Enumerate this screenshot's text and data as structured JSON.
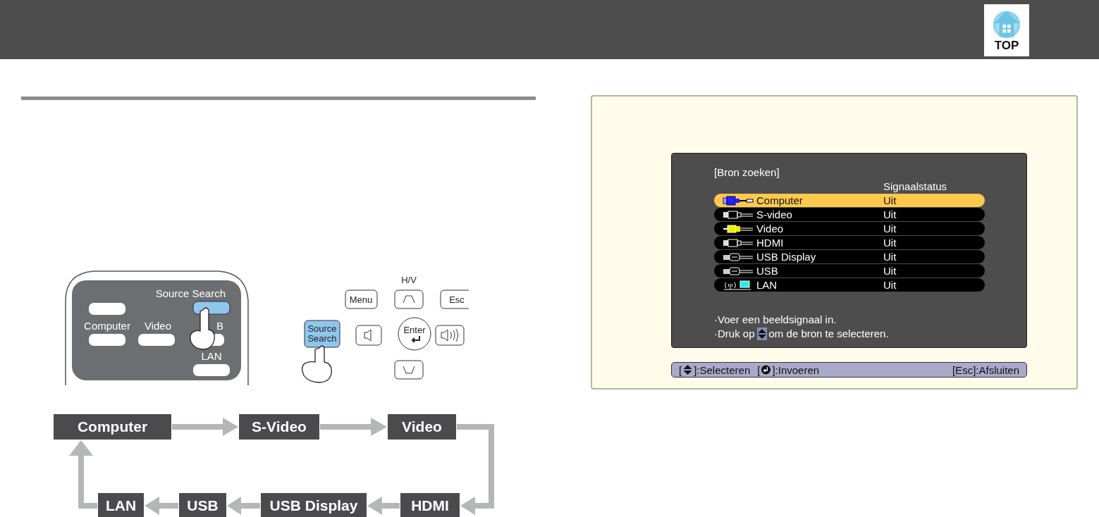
{
  "header": {
    "top_button": "TOP"
  },
  "remote": {
    "source_search": "Source Search",
    "computer": "Computer",
    "video": "Video",
    "usb": "B",
    "lan": "LAN"
  },
  "control_panel": {
    "hv": "H/V",
    "menu": "Menu",
    "esc": "Esc",
    "source_search": [
      "Source",
      "Search"
    ],
    "enter": "Enter"
  },
  "flow": {
    "nodes": [
      "Computer",
      "S-Video",
      "Video",
      "LAN",
      "USB",
      "USB Display",
      "HDMI"
    ]
  },
  "osd": {
    "title": "[Bron zoeken]",
    "status_header": "Signaalstatus",
    "rows": [
      {
        "name": "Computer",
        "status": "Uit",
        "kind": "vga",
        "selected": true
      },
      {
        "name": "S-video",
        "status": "Uit",
        "kind": "svideo",
        "selected": false
      },
      {
        "name": "Video",
        "status": "Uit",
        "kind": "rca",
        "selected": false
      },
      {
        "name": "HDMI",
        "status": "Uit",
        "kind": "hdmi",
        "selected": false
      },
      {
        "name": "USB Display",
        "status": "Uit",
        "kind": "usbdisplay",
        "selected": false
      },
      {
        "name": "USB",
        "status": "Uit",
        "kind": "usb",
        "selected": false
      },
      {
        "name": "LAN",
        "status": "Uit",
        "kind": "lan",
        "selected": false
      }
    ],
    "hint_1": "·Voer een beeldsignaal in.",
    "hint_2_before": "·Druk op",
    "hint_2_after": "om de bron te selecteren.",
    "footer": [
      {
        "kind": "updown",
        "open": "[",
        "close": "]",
        "text": ":Selecteren"
      },
      {
        "kind": "enter",
        "open": "[",
        "close": "]",
        "text": ":Invoeren"
      },
      {
        "kind": "key",
        "key": "[Esc]",
        "text": ":Afsluiten"
      }
    ]
  }
}
